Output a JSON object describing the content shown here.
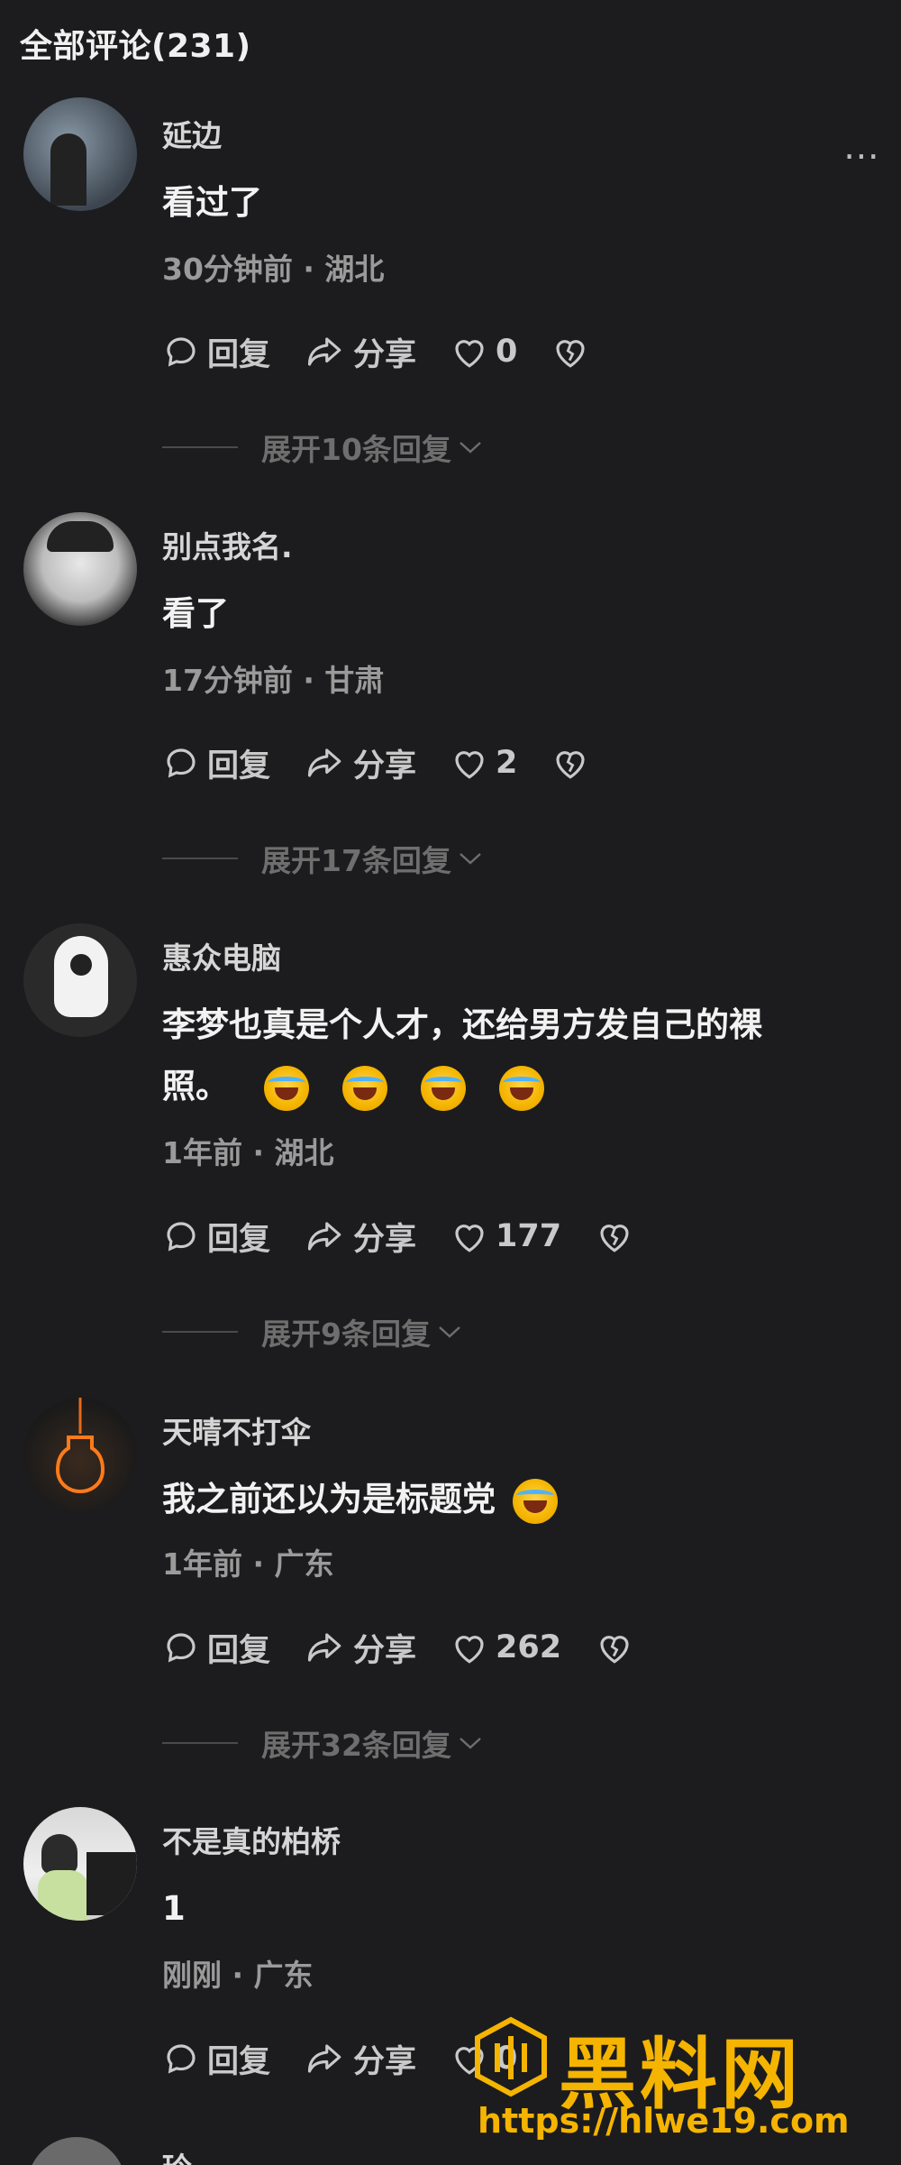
{
  "header": {
    "title": "全部评论(231)"
  },
  "more_icon": "more-dots-icon",
  "comments": [
    {
      "name": "延边",
      "text": "看过了",
      "emojis": 0,
      "time": "30分钟前",
      "location": "湖北",
      "meta": "30分钟前 · 湖北",
      "reply": "回复",
      "share": "分享",
      "likes": "0",
      "expand": "展开10条回复"
    },
    {
      "name": "别点我名.",
      "text": "看了",
      "emojis": 0,
      "time": "17分钟前",
      "location": "甘肃",
      "meta": "17分钟前 · 甘肃",
      "reply": "回复",
      "share": "分享",
      "likes": "2",
      "expand": "展开17条回复"
    },
    {
      "name": "惠众电脑",
      "text": "李梦也真是个人才，还给男方发自己的裸",
      "text2": "照。",
      "emojis": 4,
      "time": "1年前",
      "location": "湖北",
      "meta": "1年前 · 湖北",
      "reply": "回复",
      "share": "分享",
      "likes": "177",
      "expand": "展开9条回复"
    },
    {
      "name": "天晴不打伞",
      "text": "我之前还以为是标题党",
      "emojis": 1,
      "time": "1年前",
      "location": "广东",
      "meta": "1年前 · 广东",
      "reply": "回复",
      "share": "分享",
      "likes": "262",
      "expand": "展开32条回复"
    },
    {
      "name": "不是真的柏桥",
      "text": "1",
      "emojis": 0,
      "time": "刚刚",
      "location": "广东",
      "meta": "刚刚 · 广东",
      "reply": "回复",
      "share": "分享",
      "likes": "0"
    }
  ],
  "partial_next": {
    "name": "玲"
  },
  "watermark": {
    "title": "黑料网",
    "url": "https://hlwe19.com"
  },
  "colors": {
    "background": "#1c1c1e",
    "watermark": "#f5b400"
  }
}
